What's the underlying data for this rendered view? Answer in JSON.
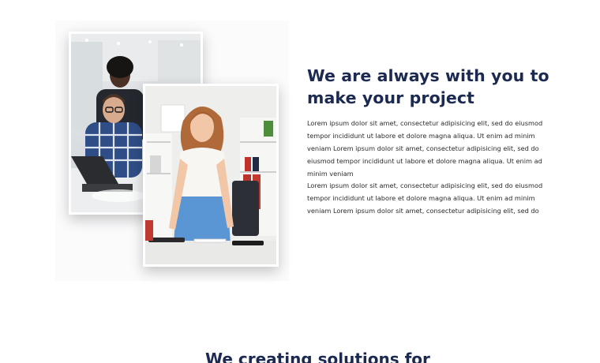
{
  "about": {
    "heading": "We are always with you to make your project",
    "paragraphs": [
      "Lorem ipsum dolor sit amet, consectetur adipisicing elit, sed do eiusmod tempor incididunt ut labore et dolore magna aliqua. Ut enim ad minim veniam Lorem ipsum dolor sit amet, consectetur adipisicing elit, sed do eiusmod tempor incididunt ut labore et dolore magna aliqua. Ut enim ad minim veniam",
      "Lorem ipsum dolor sit amet, consectetur adipisicing elit, sed do eiusmod tempor incididunt ut labore et dolore magna aliqua. Ut enim ad minim veniam Lorem ipsum dolor sit amet, consectetur adipisicing elit, sed do"
    ]
  },
  "images": {
    "back_photo": "office-team-photo",
    "front_photo": "businesswoman-photo"
  },
  "next_section": {
    "heading": "We creating solutions for"
  },
  "colors": {
    "heading": "#1c2a52",
    "body_text": "#2b2b2b",
    "background": "#ffffff"
  }
}
